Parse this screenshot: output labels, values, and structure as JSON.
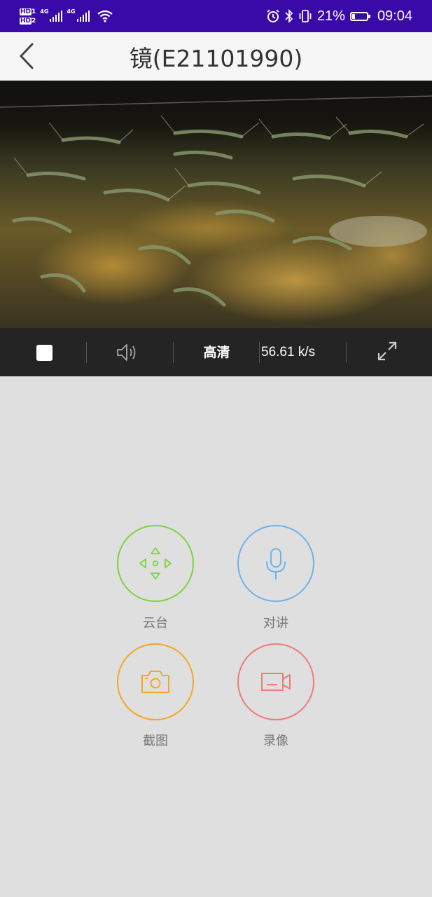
{
  "status_bar": {
    "hd1": "HD",
    "hd1_sub": "1",
    "hd2": "HD",
    "hd2_sub": "2",
    "net1": "4G",
    "net2": "4G",
    "battery_percent": "21%",
    "battery_level": 0.21,
    "time": "09:04",
    "icons": [
      "alarm-icon",
      "bluetooth-icon",
      "vibrate-icon",
      "battery-icon",
      "wifi-icon",
      "signal-icon"
    ]
  },
  "title_bar": {
    "title": "镜(E21101990)",
    "back_icon": "chevron-left-icon"
  },
  "video_controls": {
    "quality": "高清",
    "speed": "56.61 k/s",
    "icons": [
      "stop-icon",
      "volume-icon",
      "fullscreen-icon"
    ]
  },
  "actions": [
    {
      "label": "云台",
      "icon": "ptz-direction-icon",
      "color": "#7ed23f"
    },
    {
      "label": "对讲",
      "icon": "microphone-icon",
      "color": "#6fb2ec"
    },
    {
      "label": "截图",
      "icon": "camera-icon",
      "color": "#f5a623"
    },
    {
      "label": "录像",
      "icon": "video-camera-icon",
      "color": "#f07a78"
    }
  ],
  "colors": {
    "status_bar": "#3a0aa8",
    "background": "#dfdfdf",
    "control_bar": "#242424"
  }
}
